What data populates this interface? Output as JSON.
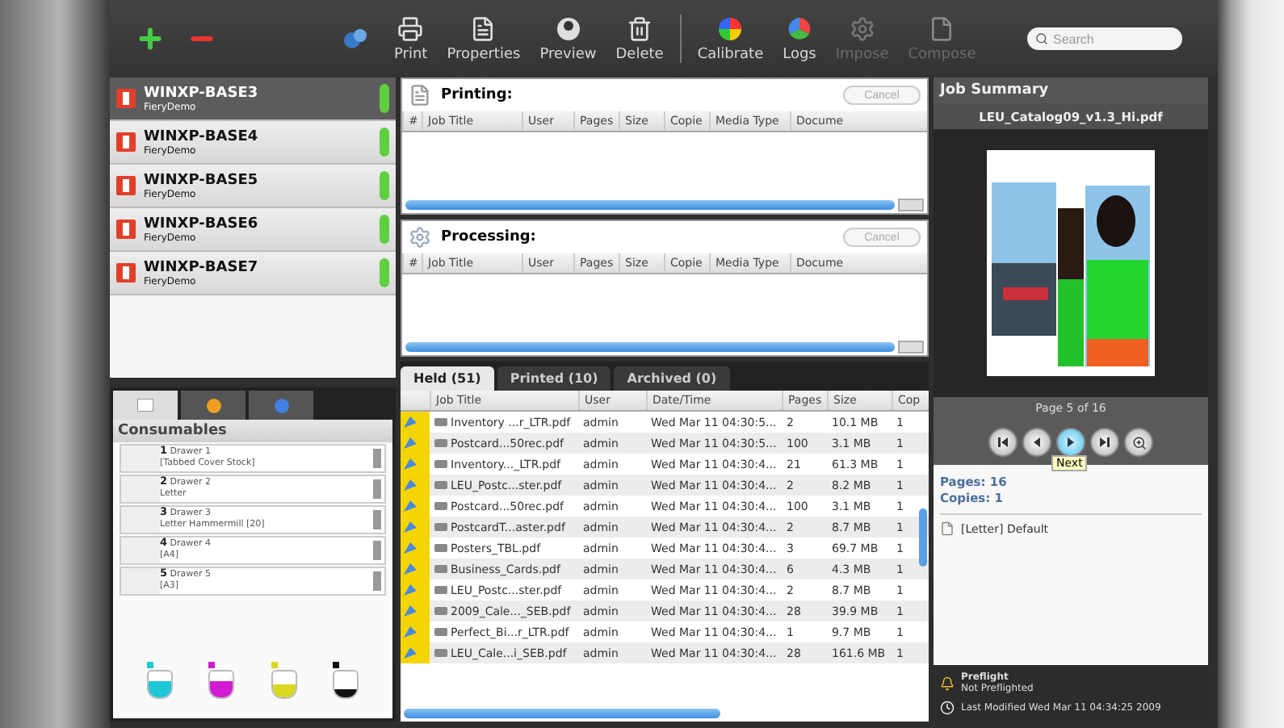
{
  "toolbar": {
    "left_actions": [
      {
        "kind": "add"
      },
      {
        "kind": "remove"
      },
      {
        "kind": "connect"
      }
    ],
    "buttons": [
      {
        "label": "Print",
        "kind": "print",
        "disabled": false
      },
      {
        "label": "Properties",
        "kind": "properties",
        "disabled": false
      },
      {
        "label": "Preview",
        "kind": "preview",
        "disabled": false
      },
      {
        "label": "Delete",
        "kind": "delete",
        "disabled": false
      },
      {
        "label": "Calibrate",
        "kind": "calibrate",
        "disabled": false
      },
      {
        "label": "Logs",
        "kind": "logs",
        "disabled": false
      },
      {
        "label": "Impose",
        "kind": "impose",
        "disabled": true
      },
      {
        "label": "Compose",
        "kind": "compose",
        "disabled": true
      }
    ],
    "search": {
      "placeholder": "Search"
    }
  },
  "servers": [
    {
      "name": "WINXP-BASE3",
      "subtitle": "FieryDemo",
      "selected": true,
      "online": true
    },
    {
      "name": "WINXP-BASE4",
      "subtitle": "FieryDemo",
      "selected": false,
      "online": true
    },
    {
      "name": "WINXP-BASE5",
      "subtitle": "FieryDemo",
      "selected": false,
      "online": true
    },
    {
      "name": "WINXP-BASE6",
      "subtitle": "FieryDemo",
      "selected": false,
      "online": true
    },
    {
      "name": "WINXP-BASE7",
      "subtitle": "FieryDemo",
      "selected": false,
      "online": true
    }
  ],
  "consumables": {
    "tabs": [
      {
        "kind": "paper",
        "selected": true
      },
      {
        "kind": "status",
        "selected": false
      },
      {
        "kind": "info",
        "selected": false
      }
    ],
    "title": "Consumables",
    "drawers": [
      {
        "number": "1",
        "name": "Drawer 1",
        "media": "[Tabbed Cover Stock]"
      },
      {
        "number": "2",
        "name": "Drawer 2",
        "media": "Letter"
      },
      {
        "number": "3",
        "name": "Drawer 3",
        "media": "Letter Hammermill [20]"
      },
      {
        "number": "4",
        "name": "Drawer 4",
        "media": "[A4]"
      },
      {
        "number": "5",
        "name": "Drawer 5",
        "media": "[A3]"
      }
    ],
    "toners": [
      {
        "color": "#1ec8d8",
        "level": 0.6
      },
      {
        "color": "#d21ad2",
        "level": 0.6
      },
      {
        "color": "#d8d820",
        "level": 0.5
      },
      {
        "color": "#111111",
        "level": 0.3
      }
    ]
  },
  "queues": [
    {
      "kind": "printing",
      "title": "Printing:",
      "cancel": {
        "label": "Cancel",
        "disabled": true
      },
      "columns": [
        "#",
        "Job Title",
        "User",
        "Pages",
        "Size",
        "Copie",
        "Media Type",
        "Docume"
      ]
    },
    {
      "kind": "processing",
      "title": "Processing:",
      "cancel": {
        "label": "Cancel",
        "disabled": true
      },
      "columns": [
        "#",
        "Job Title",
        "User",
        "Pages",
        "Size",
        "Copie",
        "Media Type",
        "Docume"
      ]
    }
  ],
  "job_list": {
    "tabs": [
      {
        "label": "Held (51)",
        "selected": true
      },
      {
        "label": "Printed (10)",
        "selected": false
      },
      {
        "label": "Archived (0)",
        "selected": false
      }
    ],
    "columns": [
      "Job Title",
      "User",
      "Date/Time",
      "Pages",
      "Size",
      "Cop"
    ],
    "rows": [
      [
        "Inventory ...r_LTR.pdf",
        "admin",
        "Wed Mar 11 04:30:5...",
        "2",
        "10.1 MB",
        "1"
      ],
      [
        "Postcard...50rec.pdf",
        "admin",
        "Wed Mar 11 04:30:5...",
        "100",
        "3.1 MB",
        "1"
      ],
      [
        "Inventory..._LTR.pdf",
        "admin",
        "Wed Mar 11 04:30:4...",
        "21",
        "61.3 MB",
        "1"
      ],
      [
        "LEU_Postc...ster.pdf",
        "admin",
        "Wed Mar 11 04:30:4...",
        "2",
        "8.2 MB",
        "1"
      ],
      [
        "Postcard...50rec.pdf",
        "admin",
        "Wed Mar 11 04:30:4...",
        "100",
        "3.1 MB",
        "1"
      ],
      [
        "PostcardT...aster.pdf",
        "admin",
        "Wed Mar 11 04:30:4...",
        "2",
        "8.7 MB",
        "1"
      ],
      [
        "Posters_TBL.pdf",
        "admin",
        "Wed Mar 11 04:30:4...",
        "3",
        "69.7 MB",
        "1"
      ],
      [
        "Business_Cards.pdf",
        "admin",
        "Wed Mar 11 04:30:4...",
        "6",
        "4.3 MB",
        "1"
      ],
      [
        "LEU_Postc...ster.pdf",
        "admin",
        "Wed Mar 11 04:30:4...",
        "2",
        "8.7 MB",
        "1"
      ],
      [
        "2009_Cale..._SEB.pdf",
        "admin",
        "Wed Mar 11 04:30:4...",
        "28",
        "39.9 MB",
        "1"
      ],
      [
        "Perfect_Bi...r_LTR.pdf",
        "admin",
        "Wed Mar 11 04:30:4...",
        "1",
        "9.7 MB",
        "1"
      ],
      [
        "LEU_Cale...i_SEB.pdf",
        "admin",
        "Wed Mar 11 04:30:4...",
        "28",
        "161.6 MB",
        "1"
      ]
    ]
  },
  "job_summary": {
    "title": "Job Summary",
    "file_name": "LEU_Catalog09_v1.3_Hi.pdf",
    "page_label": "Page 5 of 16",
    "nav": [
      {
        "kind": "first",
        "selected": false
      },
      {
        "kind": "previous",
        "selected": false
      },
      {
        "kind": "next",
        "selected": true
      },
      {
        "kind": "last",
        "selected": false
      },
      {
        "kind": "zoom",
        "selected": false
      }
    ],
    "tooltip": "Next",
    "details": [
      {
        "label": "Pages:",
        "value": "16"
      },
      {
        "label": "Copies:",
        "value": "1"
      }
    ],
    "media": "[Letter] Default",
    "preflight": {
      "title": "Preflight",
      "status": "Not Preflighted"
    },
    "last_modified": "Last Modified Wed Mar 11 04:34:25 2009"
  }
}
